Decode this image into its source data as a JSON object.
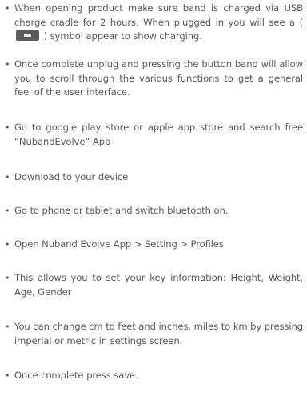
{
  "instructions": [
    {
      "text_before": "When opening product make sure band is charged via USB charge cradle for 2 hours. When plugged in you will see a ( ",
      "icon": "battery-charging-icon",
      "text_after": " ) symbol appear to show charging."
    },
    {
      "text": "Once complete unplug and pressing the button band will allow you to scroll through the various functions to get a general feel of the user interface."
    },
    {
      "text": "Go to google play store or apple app store and search free “NubandEvolve” App"
    },
    {
      "text": "Download to your device"
    },
    {
      "text": "Go to phone or tablet and switch bluetooth on."
    },
    {
      "text": "Open Nuband Evolve App > Setting > Profiles"
    },
    {
      "text": "This allows you to set your key information: Height, Weight, Age, Gender"
    },
    {
      "text": "You can change cm to feet and inches, miles to km by pressing imperial or metric in settings screen."
    },
    {
      "text": "Once complete press save."
    }
  ]
}
